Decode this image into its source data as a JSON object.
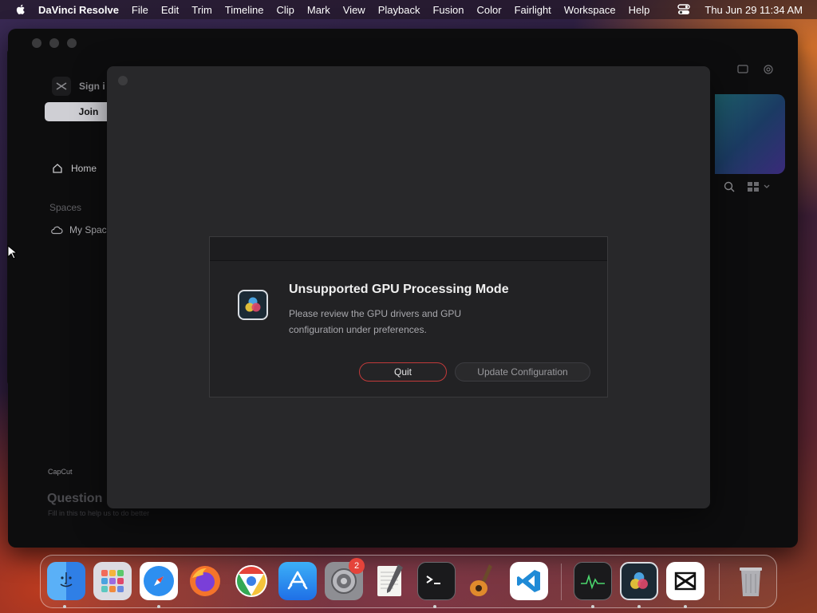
{
  "menubar": {
    "app_name": "DaVinci Resolve",
    "items": [
      "File",
      "Edit",
      "Trim",
      "Timeline",
      "Clip",
      "Mark",
      "View",
      "Playback",
      "Fusion",
      "Color",
      "Fairlight",
      "Workspace",
      "Help"
    ],
    "clock": "Thu Jun 29  11:34 AM"
  },
  "background_app": {
    "signin_label": "Sign i",
    "join_label": "Join",
    "home_label": "Home",
    "spaces_label": "Spaces",
    "my_space_label": "My Spac",
    "brand_text": "CapCut",
    "question_title": "Question",
    "question_sub": "Fill in this to help us to do better"
  },
  "dialog": {
    "title": "Unsupported GPU Processing Mode",
    "message": "Please review the GPU drivers and GPU configuration under preferences.",
    "quit_label": "Quit",
    "update_label": "Update Configuration"
  },
  "dock": {
    "items": [
      {
        "name": "Finder",
        "icon": "finder-icon",
        "running": true
      },
      {
        "name": "Launchpad",
        "icon": "launchpad-icon",
        "running": false
      },
      {
        "name": "Safari",
        "icon": "safari-icon",
        "running": true
      },
      {
        "name": "Firefox",
        "icon": "firefox-icon",
        "running": false
      },
      {
        "name": "Google Chrome",
        "icon": "chrome-icon",
        "running": false
      },
      {
        "name": "App Store",
        "icon": "app-store-icon",
        "running": false
      },
      {
        "name": "System Settings",
        "icon": "system-settings-icon",
        "running": false,
        "badge": "2"
      },
      {
        "name": "TextEdit",
        "icon": "textedit-icon",
        "running": false
      },
      {
        "name": "Terminal",
        "icon": "terminal-icon",
        "running": true
      },
      {
        "name": "GarageBand",
        "icon": "garageband-icon",
        "running": false
      },
      {
        "name": "Visual Studio Code",
        "icon": "vscode-icon",
        "running": false
      },
      {
        "name": "Activity Monitor",
        "icon": "activity-monitor-icon",
        "running": true
      },
      {
        "name": "DaVinci Resolve",
        "icon": "davinci-resolve-icon",
        "running": true
      },
      {
        "name": "CapCut",
        "icon": "capcut-icon",
        "running": true
      },
      {
        "name": "Trash",
        "icon": "trash-icon",
        "running": false
      }
    ]
  },
  "colors": {
    "accent_red": "#c23a3a",
    "dialog_bg": "#222224",
    "badge_red": "#e5433a"
  }
}
